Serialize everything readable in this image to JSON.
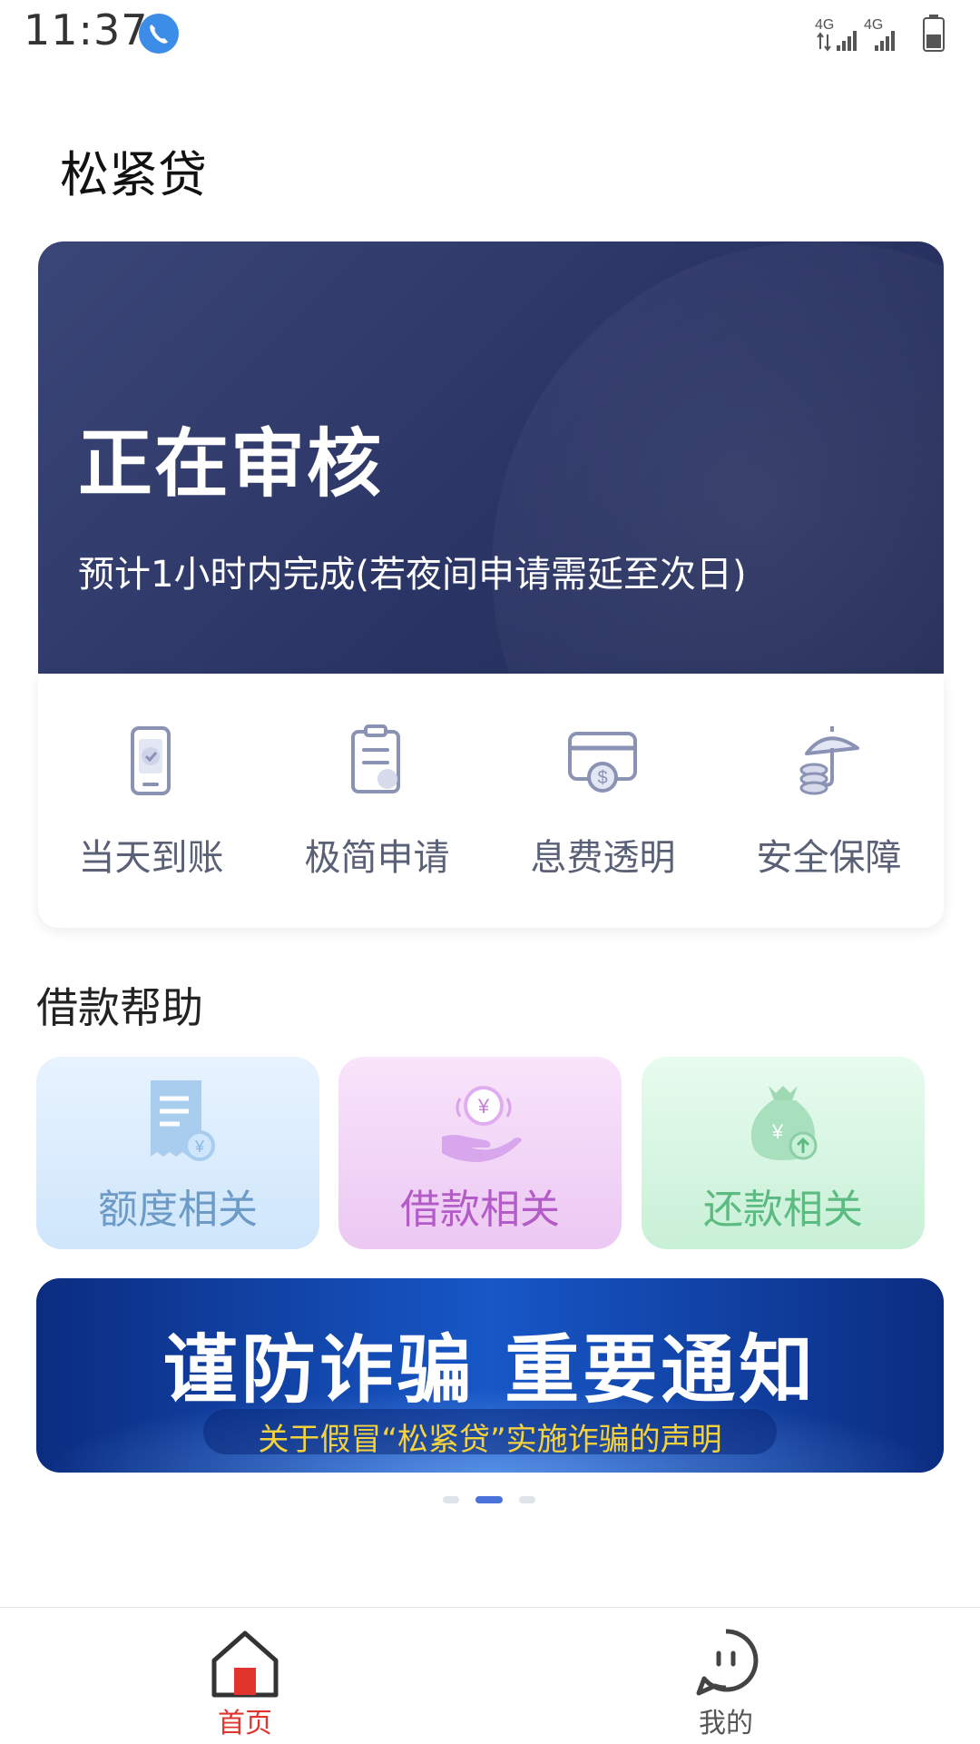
{
  "status_bar": {
    "time": "11:37",
    "call_icon": "phone-call-icon",
    "network_1": "4G",
    "network_2": "4G"
  },
  "app": {
    "title": "松紧贷"
  },
  "hero": {
    "title": "正在审核",
    "subtitle": "预计1小时内完成(若夜间申请需延至次日)"
  },
  "features": [
    {
      "label": "当天到账",
      "icon": "phone-check-icon"
    },
    {
      "label": "极简申请",
      "icon": "document-icon"
    },
    {
      "label": "息费透明",
      "icon": "card-dollar-icon"
    },
    {
      "label": "安全保障",
      "icon": "umbrella-coins-icon"
    }
  ],
  "help": {
    "title": "借款帮助",
    "items": [
      {
        "label": "额度相关",
        "icon": "receipt-yen-icon",
        "color": "#6d9bc7"
      },
      {
        "label": "借款相关",
        "icon": "hand-yen-icon",
        "color": "#b35cc8"
      },
      {
        "label": "还款相关",
        "icon": "moneybag-up-icon",
        "color": "#5bbb80"
      }
    ]
  },
  "banner": {
    "title": "谨防诈骗  重要通知",
    "subtitle": "关于假冒“松紧贷”实施诈骗的声明"
  },
  "carousel": {
    "count": 3,
    "active_index": 1,
    "active_color": "#4a73d9"
  },
  "bottom_nav": {
    "items": [
      {
        "label": "首页",
        "icon": "home-icon",
        "active": true
      },
      {
        "label": "我的",
        "icon": "profile-face-icon",
        "active": false
      }
    ],
    "active_color": "#e0342c"
  }
}
